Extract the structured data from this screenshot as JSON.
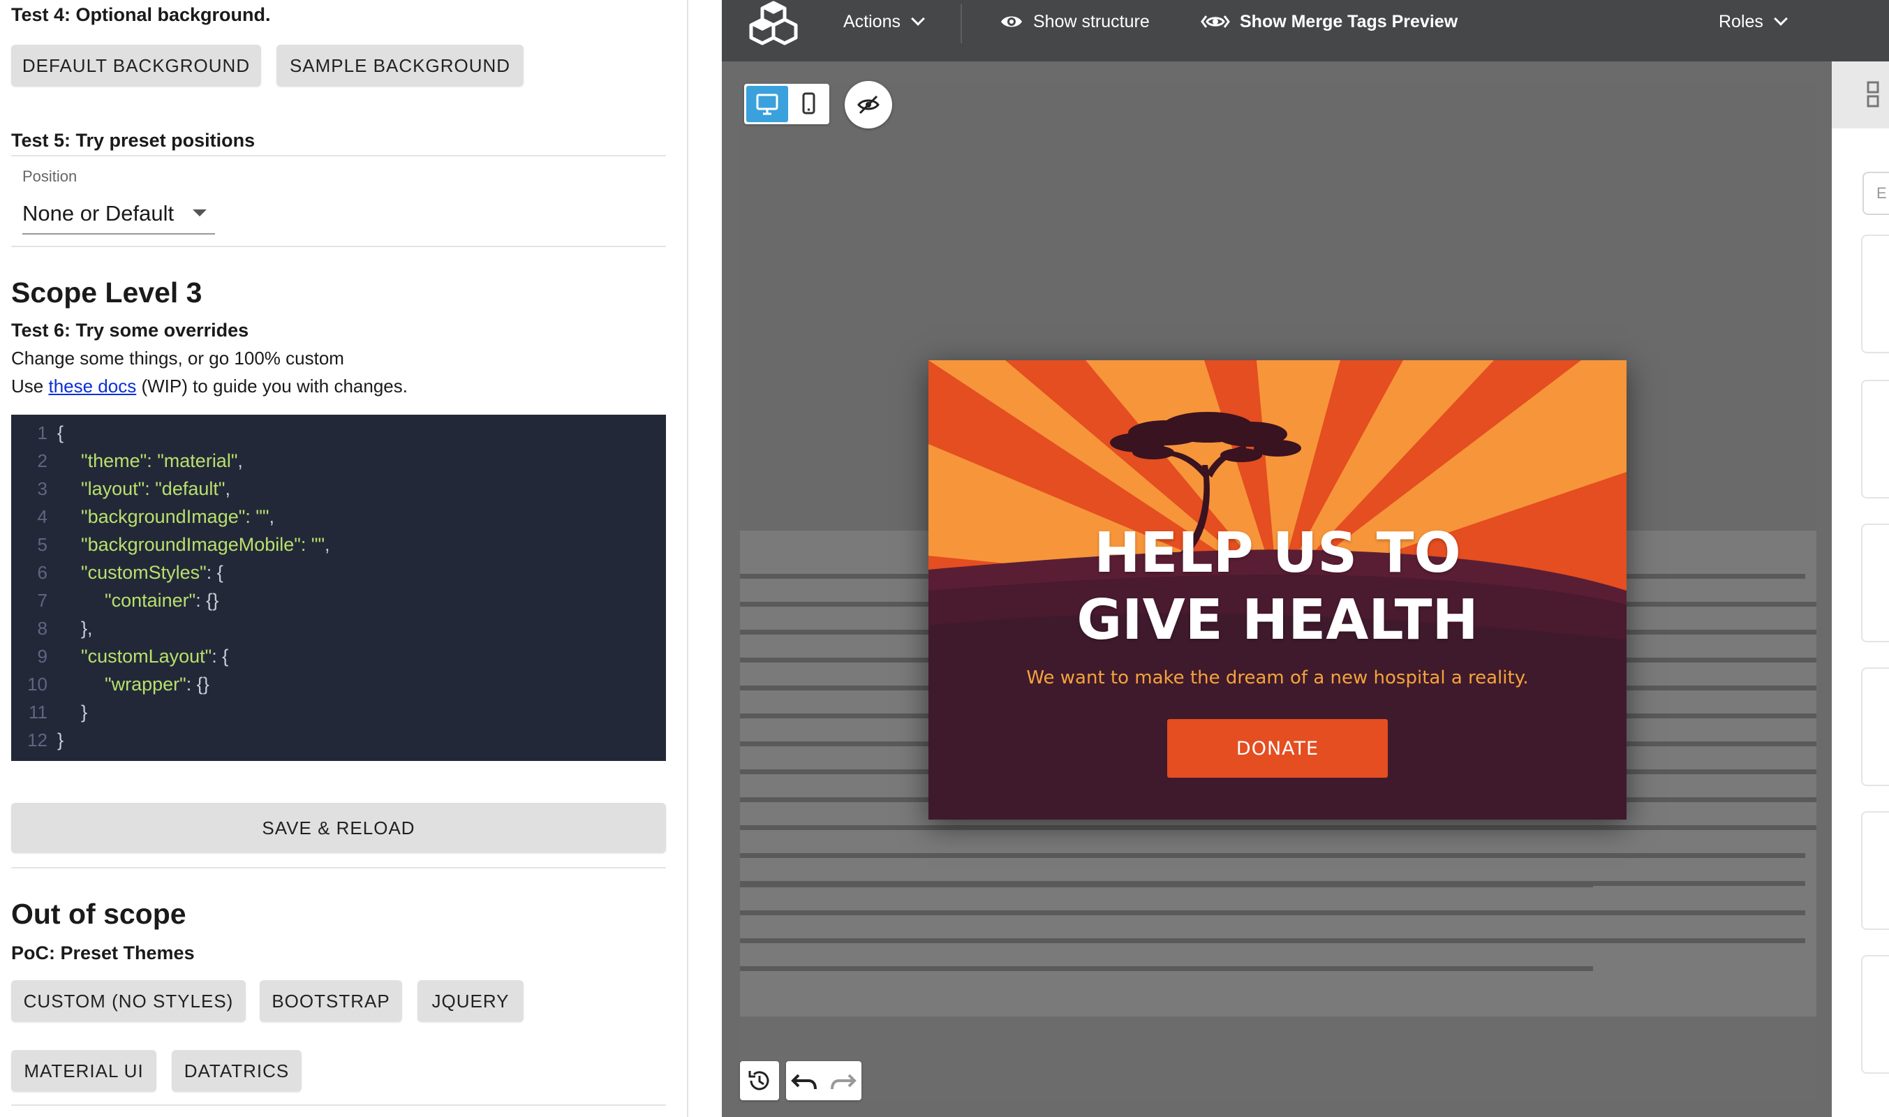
{
  "left": {
    "test4": {
      "heading": "Test 4: Optional background.",
      "buttons": [
        "DEFAULT BACKGROUND",
        "SAMPLE BACKGROUND"
      ]
    },
    "test5": {
      "heading": "Test 5: Try preset positions",
      "select_label": "Position",
      "select_value": "None or Default"
    },
    "scope3": {
      "heading": "Scope Level 3",
      "test6_heading": "Test 6: Try some overrides",
      "line1": "Change some things, or go 100% custom",
      "line2_prefix": "Use ",
      "line2_link": "these docs",
      "line2_suffix": " (WIP) to guide you with changes."
    },
    "code": {
      "lines": [
        {
          "n": "1",
          "indent": "",
          "key": "",
          "punct": "{"
        },
        {
          "n": "2",
          "indent": "  ",
          "key": "\"theme\": \"material\"",
          "punct": ","
        },
        {
          "n": "3",
          "indent": "  ",
          "key": "\"layout\": \"default\"",
          "punct": ","
        },
        {
          "n": "4",
          "indent": "  ",
          "key": "\"backgroundImage\": \"\"",
          "punct": ","
        },
        {
          "n": "5",
          "indent": "  ",
          "key": "\"backgroundImageMobile\": \"\"",
          "punct": ","
        },
        {
          "n": "6",
          "indent": "  ",
          "key": "\"customStyles\"",
          "punct": ": {"
        },
        {
          "n": "7",
          "indent": "    ",
          "key": "\"container\"",
          "punct": ": {}"
        },
        {
          "n": "8",
          "indent": "  ",
          "key": "",
          "punct": "},"
        },
        {
          "n": "9",
          "indent": "  ",
          "key": "\"customLayout\"",
          "punct": ": {"
        },
        {
          "n": "10",
          "indent": "    ",
          "key": "\"wrapper\"",
          "punct": ": {}"
        },
        {
          "n": "11",
          "indent": "  ",
          "key": "",
          "punct": "}"
        },
        {
          "n": "12",
          "indent": "",
          "key": "",
          "punct": "}"
        }
      ]
    },
    "save_reload": "SAVE & RELOAD",
    "out_of_scope": {
      "heading": "Out of scope",
      "sub": "PoC: Preset Themes",
      "buttons": [
        "CUSTOM (NO STYLES)",
        "BOOTSTRAP",
        "JQUERY",
        "MATERIAL UI",
        "DATATRICS"
      ]
    }
  },
  "editor": {
    "toolbar": {
      "actions": "Actions",
      "show_structure": "Show structure",
      "show_merge_tags": "Show Merge Tags Preview",
      "roles": "Roles"
    },
    "popup": {
      "title_line1": "HELP US TO",
      "title_line2": "GIVE HEALTH",
      "subtitle": "We want to make the dream of a new hospital a reality.",
      "cta": "DONATE"
    },
    "side_input_placeholder": "E",
    "colors": {
      "toolbar_bg": "#454749",
      "accent_blue": "#3aa1dc",
      "popup_orange": "#e44e20",
      "popup_light_orange": "#f7953a",
      "popup_dark": "#3f1a2c",
      "subtitle_color": "#f6a33c",
      "code_bg": "#232838",
      "code_key": "#b7e06d"
    }
  }
}
